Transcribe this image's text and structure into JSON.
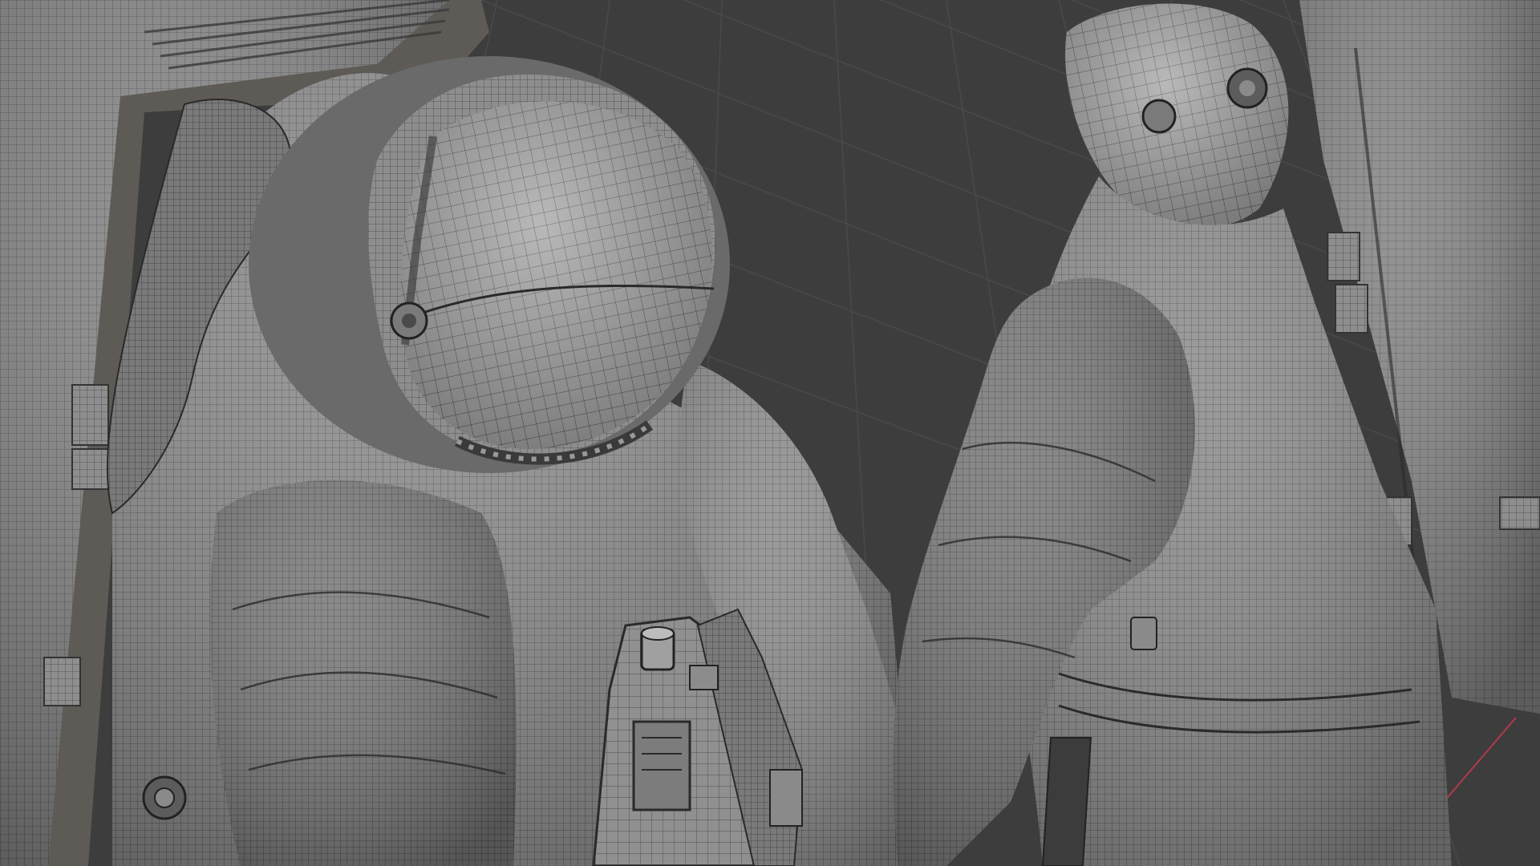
{
  "viewport": {
    "background_color": "#3d3d3d",
    "floor_grid_color": "#4a4a4a",
    "mesh_fill_color": "#8c8c8c",
    "mesh_line_color": "#2a2a2a",
    "axis_x_color": "#b23a48"
  },
  "scene": {
    "objects": [
      {
        "name": "astronaut-left",
        "parts": [
          "backpack",
          "helmet",
          "visor",
          "torso",
          "right-arm",
          "chest-control-unit"
        ]
      },
      {
        "name": "astronaut-right",
        "parts": [
          "helmet",
          "torso",
          "arm",
          "backpack"
        ]
      }
    ],
    "shading_mode": "wireframe-overlay"
  }
}
